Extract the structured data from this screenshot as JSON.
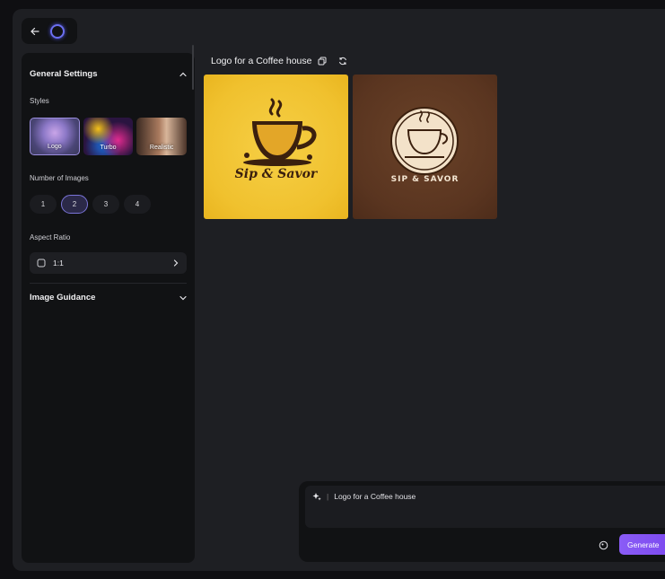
{
  "sidebar": {
    "general_settings_title": "General Settings",
    "styles_label": "Styles",
    "styles": [
      {
        "label": "Logo",
        "selected": true
      },
      {
        "label": "Turbo",
        "selected": false
      },
      {
        "label": "Realistic",
        "selected": false
      }
    ],
    "number_of_images_label": "Number of Images",
    "number_options": [
      "1",
      "2",
      "3",
      "4"
    ],
    "number_selected": "2",
    "aspect_ratio_label": "Aspect Ratio",
    "aspect_ratio_value": "1:1",
    "image_guidance_title": "Image Guidance"
  },
  "main": {
    "title": "Logo for a Coffee house",
    "images": [
      {
        "logo_text": "Sip & Savor"
      },
      {
        "logo_text": "SIP & SAVOR"
      }
    ]
  },
  "prompt": {
    "text": "Logo for a Coffee house",
    "generate_label": "Generate"
  },
  "colors": {
    "accent": "#7c4ff0",
    "background": "#1e1f23",
    "panel": "#111214"
  }
}
